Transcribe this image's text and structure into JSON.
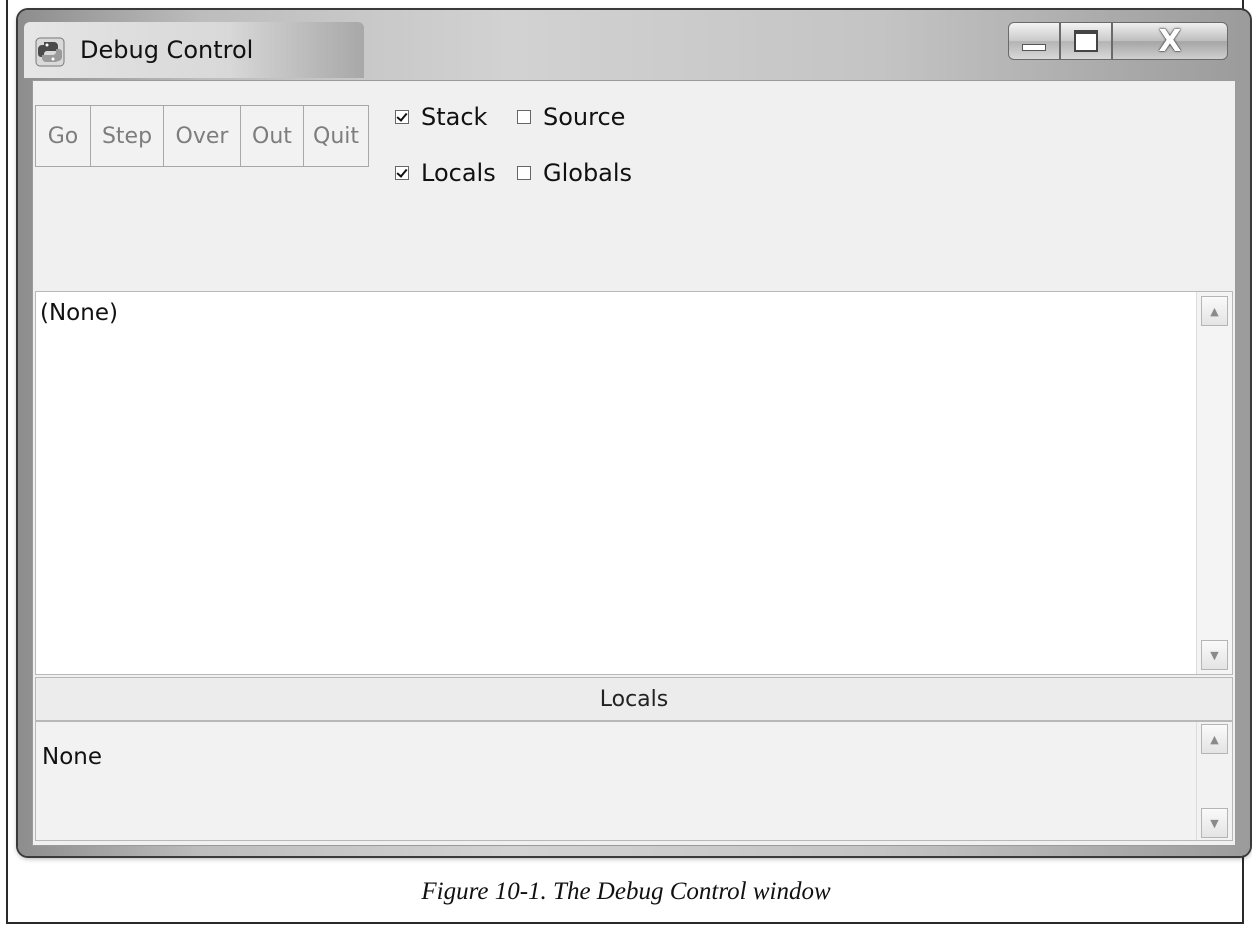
{
  "window": {
    "title": "Debug Control",
    "icon": "python-idle-icon",
    "controls": [
      "minimize",
      "maximize",
      "close"
    ]
  },
  "toolbar": {
    "buttons": [
      {
        "label": "Go",
        "enabled": false
      },
      {
        "label": "Step",
        "enabled": false
      },
      {
        "label": "Over",
        "enabled": false
      },
      {
        "label": "Out",
        "enabled": false
      },
      {
        "label": "Quit",
        "enabled": false
      }
    ],
    "checkboxes": [
      {
        "label": "Stack",
        "checked": true
      },
      {
        "label": "Source",
        "checked": false
      },
      {
        "label": "Locals",
        "checked": true
      },
      {
        "label": "Globals",
        "checked": false
      }
    ]
  },
  "stack_pane": {
    "text": "(None)"
  },
  "locals_section": {
    "header": "Locals",
    "text": "None"
  },
  "caption": "Figure 10-1. The Debug Control window"
}
